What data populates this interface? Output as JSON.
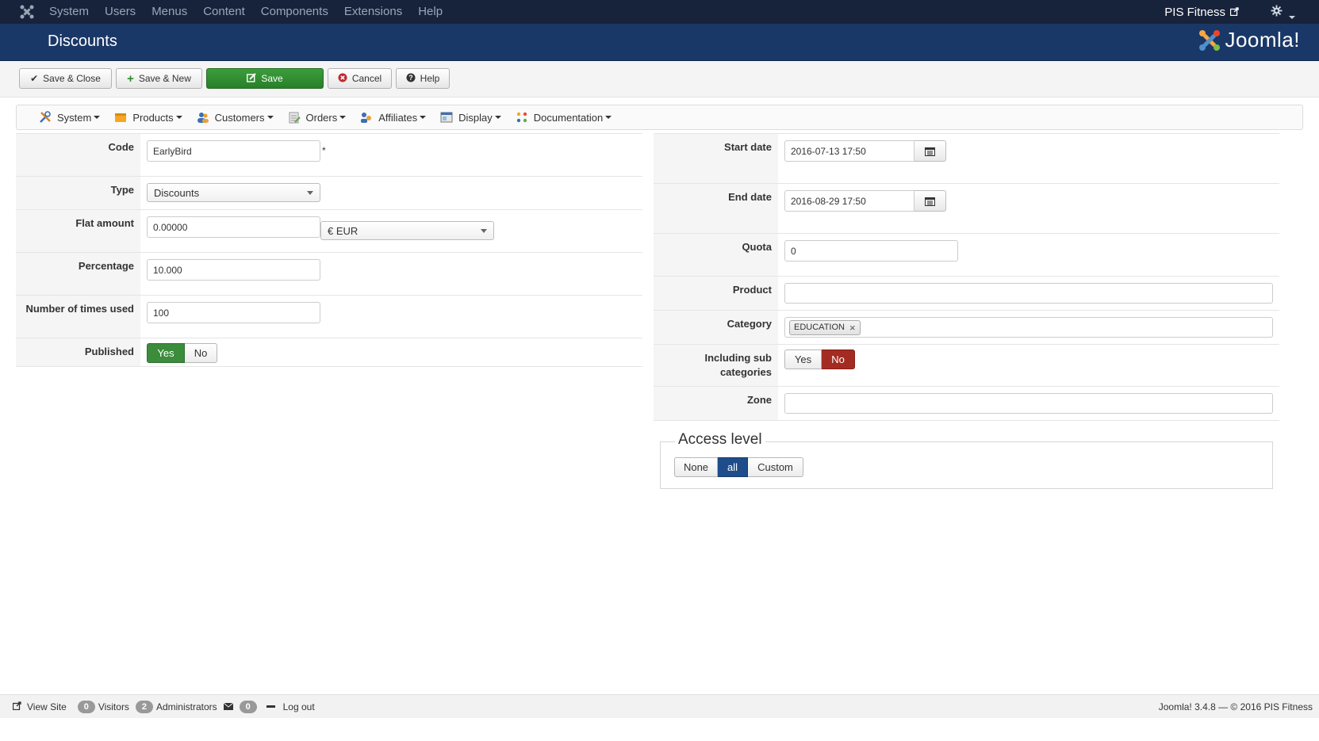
{
  "topnav": {
    "menu": [
      "System",
      "Users",
      "Menus",
      "Content",
      "Components",
      "Extensions",
      "Help"
    ],
    "site_name": "PIS Fitness"
  },
  "titlebar": {
    "title": "Discounts",
    "logo_word": "Joomla!"
  },
  "toolbar": {
    "save_close": "Save & Close",
    "save_new": "Save & New",
    "save": "Save",
    "cancel": "Cancel",
    "help": "Help"
  },
  "submenu": [
    "System",
    "Products",
    "Customers",
    "Orders",
    "Affiliates",
    "Display",
    "Documentation"
  ],
  "left_form": {
    "code_label": "Code",
    "code_value": "EarlyBird",
    "required_mark": "*",
    "type_label": "Type",
    "type_value": "Discounts",
    "flat_label": "Flat amount",
    "flat_value": "0.00000",
    "currency_value": "€ EUR",
    "percentage_label": "Percentage",
    "percentage_value": "10.000",
    "times_label": "Number of times used",
    "times_value": "100",
    "published_label": "Published",
    "yes": "Yes",
    "no": "No",
    "published_state": "Yes"
  },
  "right_form": {
    "start_label": "Start date",
    "start_value": "2016-07-13 17:50",
    "end_label": "End date",
    "end_value": "2016-08-29 17:50",
    "quota_label": "Quota",
    "quota_value": "0",
    "product_label": "Product",
    "product_value": "",
    "category_label": "Category",
    "category_tag": "EDUCATION",
    "sub_label_1": "Including sub",
    "sub_label_2": "categories",
    "sub_yes": "Yes",
    "sub_no": "No",
    "sub_state": "No",
    "zone_label": "Zone",
    "zone_value": ""
  },
  "access": {
    "legend": "Access level",
    "options": [
      "None",
      "all",
      "Custom"
    ],
    "selected": "all"
  },
  "footer": {
    "view_site": "View Site",
    "visitors_count": "0",
    "visitors_label": "Visitors",
    "admins_count": "2",
    "admins_label": "Administrators",
    "messages_count": "0",
    "logout": "Log out",
    "version": "Joomla! 3.4.8  —  © 2016 PIS Fitness"
  },
  "colors": {
    "topnav": "#17233a",
    "titlebar": "#1a3867",
    "save_green": "#2f8a2f",
    "no_red": "#a32b22",
    "all_blue": "#1f4c8a"
  }
}
